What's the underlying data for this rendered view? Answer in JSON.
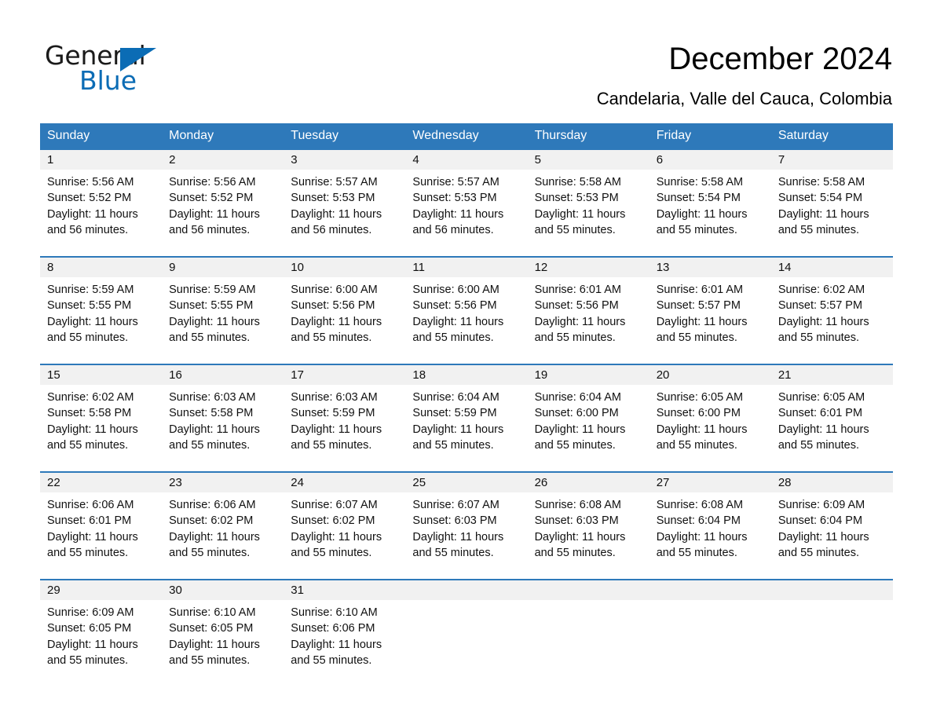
{
  "brand": {
    "name_part1": "General",
    "name_part2": "Blue",
    "triangle_color": "#0b6cb5",
    "accent_color": "#2e79ba"
  },
  "header": {
    "title": "December 2024",
    "subtitle": "Candelaria, Valle del Cauca, Colombia"
  },
  "calendar": {
    "weekday_headers": [
      "Sunday",
      "Monday",
      "Tuesday",
      "Wednesday",
      "Thursday",
      "Friday",
      "Saturday"
    ],
    "labels": {
      "sunrise_prefix": "Sunrise:",
      "sunset_prefix": "Sunset:",
      "daylight_prefix": "Daylight:"
    },
    "weeks": [
      {
        "days": [
          {
            "date": "1",
            "sunrise": "Sunrise: 5:56 AM",
            "sunset": "Sunset: 5:52 PM",
            "daylight_line1": "Daylight: 11 hours",
            "daylight_line2": "and 56 minutes."
          },
          {
            "date": "2",
            "sunrise": "Sunrise: 5:56 AM",
            "sunset": "Sunset: 5:52 PM",
            "daylight_line1": "Daylight: 11 hours",
            "daylight_line2": "and 56 minutes."
          },
          {
            "date": "3",
            "sunrise": "Sunrise: 5:57 AM",
            "sunset": "Sunset: 5:53 PM",
            "daylight_line1": "Daylight: 11 hours",
            "daylight_line2": "and 56 minutes."
          },
          {
            "date": "4",
            "sunrise": "Sunrise: 5:57 AM",
            "sunset": "Sunset: 5:53 PM",
            "daylight_line1": "Daylight: 11 hours",
            "daylight_line2": "and 56 minutes."
          },
          {
            "date": "5",
            "sunrise": "Sunrise: 5:58 AM",
            "sunset": "Sunset: 5:53 PM",
            "daylight_line1": "Daylight: 11 hours",
            "daylight_line2": "and 55 minutes."
          },
          {
            "date": "6",
            "sunrise": "Sunrise: 5:58 AM",
            "sunset": "Sunset: 5:54 PM",
            "daylight_line1": "Daylight: 11 hours",
            "daylight_line2": "and 55 minutes."
          },
          {
            "date": "7",
            "sunrise": "Sunrise: 5:58 AM",
            "sunset": "Sunset: 5:54 PM",
            "daylight_line1": "Daylight: 11 hours",
            "daylight_line2": "and 55 minutes."
          }
        ]
      },
      {
        "days": [
          {
            "date": "8",
            "sunrise": "Sunrise: 5:59 AM",
            "sunset": "Sunset: 5:55 PM",
            "daylight_line1": "Daylight: 11 hours",
            "daylight_line2": "and 55 minutes."
          },
          {
            "date": "9",
            "sunrise": "Sunrise: 5:59 AM",
            "sunset": "Sunset: 5:55 PM",
            "daylight_line1": "Daylight: 11 hours",
            "daylight_line2": "and 55 minutes."
          },
          {
            "date": "10",
            "sunrise": "Sunrise: 6:00 AM",
            "sunset": "Sunset: 5:56 PM",
            "daylight_line1": "Daylight: 11 hours",
            "daylight_line2": "and 55 minutes."
          },
          {
            "date": "11",
            "sunrise": "Sunrise: 6:00 AM",
            "sunset": "Sunset: 5:56 PM",
            "daylight_line1": "Daylight: 11 hours",
            "daylight_line2": "and 55 minutes."
          },
          {
            "date": "12",
            "sunrise": "Sunrise: 6:01 AM",
            "sunset": "Sunset: 5:56 PM",
            "daylight_line1": "Daylight: 11 hours",
            "daylight_line2": "and 55 minutes."
          },
          {
            "date": "13",
            "sunrise": "Sunrise: 6:01 AM",
            "sunset": "Sunset: 5:57 PM",
            "daylight_line1": "Daylight: 11 hours",
            "daylight_line2": "and 55 minutes."
          },
          {
            "date": "14",
            "sunrise": "Sunrise: 6:02 AM",
            "sunset": "Sunset: 5:57 PM",
            "daylight_line1": "Daylight: 11 hours",
            "daylight_line2": "and 55 minutes."
          }
        ]
      },
      {
        "days": [
          {
            "date": "15",
            "sunrise": "Sunrise: 6:02 AM",
            "sunset": "Sunset: 5:58 PM",
            "daylight_line1": "Daylight: 11 hours",
            "daylight_line2": "and 55 minutes."
          },
          {
            "date": "16",
            "sunrise": "Sunrise: 6:03 AM",
            "sunset": "Sunset: 5:58 PM",
            "daylight_line1": "Daylight: 11 hours",
            "daylight_line2": "and 55 minutes."
          },
          {
            "date": "17",
            "sunrise": "Sunrise: 6:03 AM",
            "sunset": "Sunset: 5:59 PM",
            "daylight_line1": "Daylight: 11 hours",
            "daylight_line2": "and 55 minutes."
          },
          {
            "date": "18",
            "sunrise": "Sunrise: 6:04 AM",
            "sunset": "Sunset: 5:59 PM",
            "daylight_line1": "Daylight: 11 hours",
            "daylight_line2": "and 55 minutes."
          },
          {
            "date": "19",
            "sunrise": "Sunrise: 6:04 AM",
            "sunset": "Sunset: 6:00 PM",
            "daylight_line1": "Daylight: 11 hours",
            "daylight_line2": "and 55 minutes."
          },
          {
            "date": "20",
            "sunrise": "Sunrise: 6:05 AM",
            "sunset": "Sunset: 6:00 PM",
            "daylight_line1": "Daylight: 11 hours",
            "daylight_line2": "and 55 minutes."
          },
          {
            "date": "21",
            "sunrise": "Sunrise: 6:05 AM",
            "sunset": "Sunset: 6:01 PM",
            "daylight_line1": "Daylight: 11 hours",
            "daylight_line2": "and 55 minutes."
          }
        ]
      },
      {
        "days": [
          {
            "date": "22",
            "sunrise": "Sunrise: 6:06 AM",
            "sunset": "Sunset: 6:01 PM",
            "daylight_line1": "Daylight: 11 hours",
            "daylight_line2": "and 55 minutes."
          },
          {
            "date": "23",
            "sunrise": "Sunrise: 6:06 AM",
            "sunset": "Sunset: 6:02 PM",
            "daylight_line1": "Daylight: 11 hours",
            "daylight_line2": "and 55 minutes."
          },
          {
            "date": "24",
            "sunrise": "Sunrise: 6:07 AM",
            "sunset": "Sunset: 6:02 PM",
            "daylight_line1": "Daylight: 11 hours",
            "daylight_line2": "and 55 minutes."
          },
          {
            "date": "25",
            "sunrise": "Sunrise: 6:07 AM",
            "sunset": "Sunset: 6:03 PM",
            "daylight_line1": "Daylight: 11 hours",
            "daylight_line2": "and 55 minutes."
          },
          {
            "date": "26",
            "sunrise": "Sunrise: 6:08 AM",
            "sunset": "Sunset: 6:03 PM",
            "daylight_line1": "Daylight: 11 hours",
            "daylight_line2": "and 55 minutes."
          },
          {
            "date": "27",
            "sunrise": "Sunrise: 6:08 AM",
            "sunset": "Sunset: 6:04 PM",
            "daylight_line1": "Daylight: 11 hours",
            "daylight_line2": "and 55 minutes."
          },
          {
            "date": "28",
            "sunrise": "Sunrise: 6:09 AM",
            "sunset": "Sunset: 6:04 PM",
            "daylight_line1": "Daylight: 11 hours",
            "daylight_line2": "and 55 minutes."
          }
        ]
      },
      {
        "days": [
          {
            "date": "29",
            "sunrise": "Sunrise: 6:09 AM",
            "sunset": "Sunset: 6:05 PM",
            "daylight_line1": "Daylight: 11 hours",
            "daylight_line2": "and 55 minutes."
          },
          {
            "date": "30",
            "sunrise": "Sunrise: 6:10 AM",
            "sunset": "Sunset: 6:05 PM",
            "daylight_line1": "Daylight: 11 hours",
            "daylight_line2": "and 55 minutes."
          },
          {
            "date": "31",
            "sunrise": "Sunrise: 6:10 AM",
            "sunset": "Sunset: 6:06 PM",
            "daylight_line1": "Daylight: 11 hours",
            "daylight_line2": "and 55 minutes."
          },
          {
            "date": "",
            "sunrise": "",
            "sunset": "",
            "daylight_line1": "",
            "daylight_line2": ""
          },
          {
            "date": "",
            "sunrise": "",
            "sunset": "",
            "daylight_line1": "",
            "daylight_line2": ""
          },
          {
            "date": "",
            "sunrise": "",
            "sunset": "",
            "daylight_line1": "",
            "daylight_line2": ""
          },
          {
            "date": "",
            "sunrise": "",
            "sunset": "",
            "daylight_line1": "",
            "daylight_line2": ""
          }
        ]
      }
    ]
  }
}
